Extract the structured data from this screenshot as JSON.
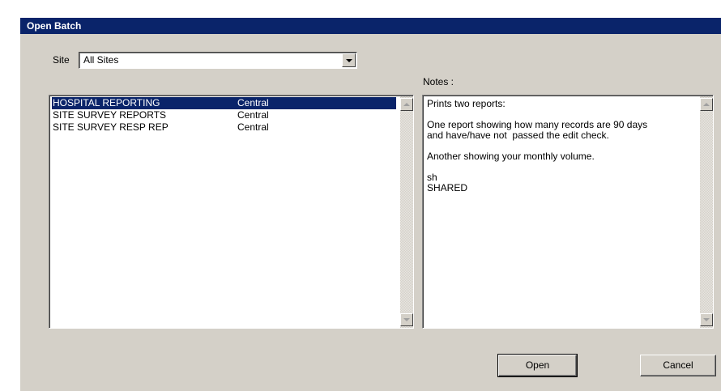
{
  "window": {
    "title": "Open Batch"
  },
  "site": {
    "label": "Site",
    "selected": "All Sites"
  },
  "notes": {
    "label": "Notes :",
    "lines": [
      "Prints two reports:",
      "",
      "One report showing how many records are 90 days",
      "and have/have not  passed the edit check.",
      "",
      "Another showing your monthly volume.",
      "",
      "sh",
      "SHARED"
    ]
  },
  "batches": [
    {
      "name": "HOSPITAL REPORTING",
      "site": "Central",
      "selected": true
    },
    {
      "name": "SITE SURVEY REPORTS",
      "site": "Central",
      "selected": false
    },
    {
      "name": "SITE SURVEY RESP REP",
      "site": "Central",
      "selected": false
    }
  ],
  "buttons": {
    "open": "Open",
    "cancel": "Cancel"
  },
  "colors": {
    "titlebar": "#0a246a",
    "dialog_bg": "#d4d0c8",
    "selection": "#0a246a"
  }
}
